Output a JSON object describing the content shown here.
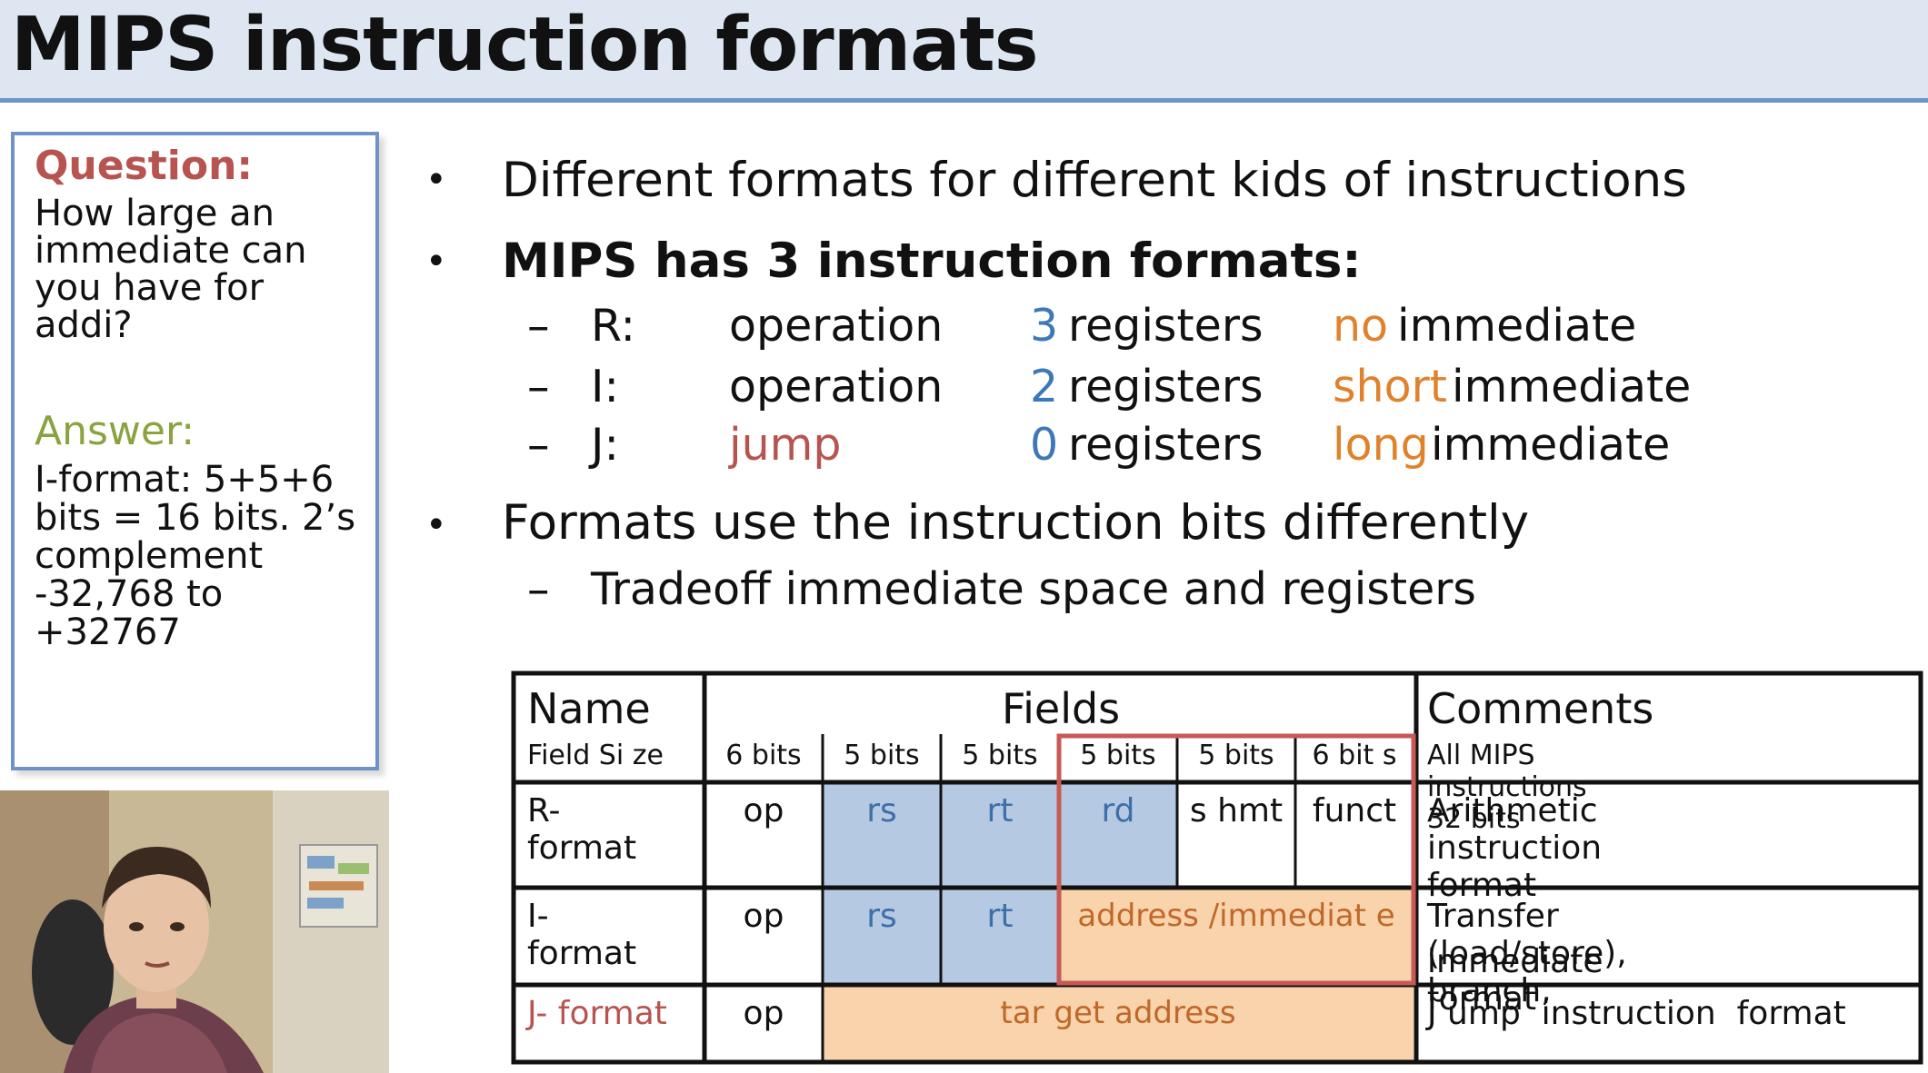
{
  "slide": {
    "title": "MIPS instruction formats"
  },
  "question_box": {
    "question_heading": "Question:",
    "question_text": "How large an immediate can you have for addi?",
    "answer_heading": "Answer:",
    "answer_text": "I-format: 5+5+6 bits = 16 bits. 2’s complement -32,768 to +32767"
  },
  "bullets": {
    "b1": "Different formats for different kids of instructions",
    "b2": "MIPS has 3 instruction formats:",
    "formats": [
      {
        "name": "R:",
        "op": "operation",
        "regs_num": "3",
        "regs_word": "registers",
        "imm_kind": "no",
        "imm_word": "immediate"
      },
      {
        "name": "I:",
        "op": "operation",
        "regs_num": "2",
        "regs_word": "registers",
        "imm_kind": "short",
        "imm_word": "immediate"
      },
      {
        "name": "J:",
        "op": "jump",
        "regs_num": "0",
        "regs_word": "registers",
        "imm_kind": "long",
        "imm_word": "immediate"
      }
    ],
    "b3": "Formats use the instruction bits differently",
    "b3_sub": "Tradeoff immediate space and registers",
    "dash": "–",
    "bullet_char": "•"
  },
  "table": {
    "header": {
      "name": "Name",
      "fields": "Fields",
      "comments": "Comments"
    },
    "field_size_label": "Field Si ze",
    "sizes": [
      "6 bits",
      "5 bits",
      "5 bits",
      "5 bits",
      "5 bits",
      "6 bit s"
    ],
    "size_comment": "All MIPS instructions 32 bits",
    "rows": [
      {
        "name": "R-format",
        "cells": [
          "op",
          "rs",
          "rt",
          "rd",
          "s hmt",
          "funct"
        ],
        "comment": "Arithmetic instruction format"
      },
      {
        "name": "I-format",
        "cells": [
          "op",
          "rs",
          "rt",
          "address /immediat e"
        ],
        "comment_line1": "Transfer (load/store), branch,",
        "comment_line2": "immediate format"
      },
      {
        "name": "J- format",
        "cells": [
          "op",
          "tar get address"
        ],
        "comment": "J ump  instruction  format"
      }
    ]
  },
  "colors": {
    "title_bg": "#dde6f1",
    "accent_blue": "#6f93c6",
    "register_fill": "#b6c9e3",
    "immediate_fill": "#f9d3ab",
    "highlight_red": "#c75a55",
    "number_blue": "#3d78b9",
    "imm_orange": "#e0822c",
    "question_red": "#b85450",
    "answer_green": "#8aa23f"
  },
  "icons": {
    "video_thumbnail": "presenter-webcam"
  }
}
